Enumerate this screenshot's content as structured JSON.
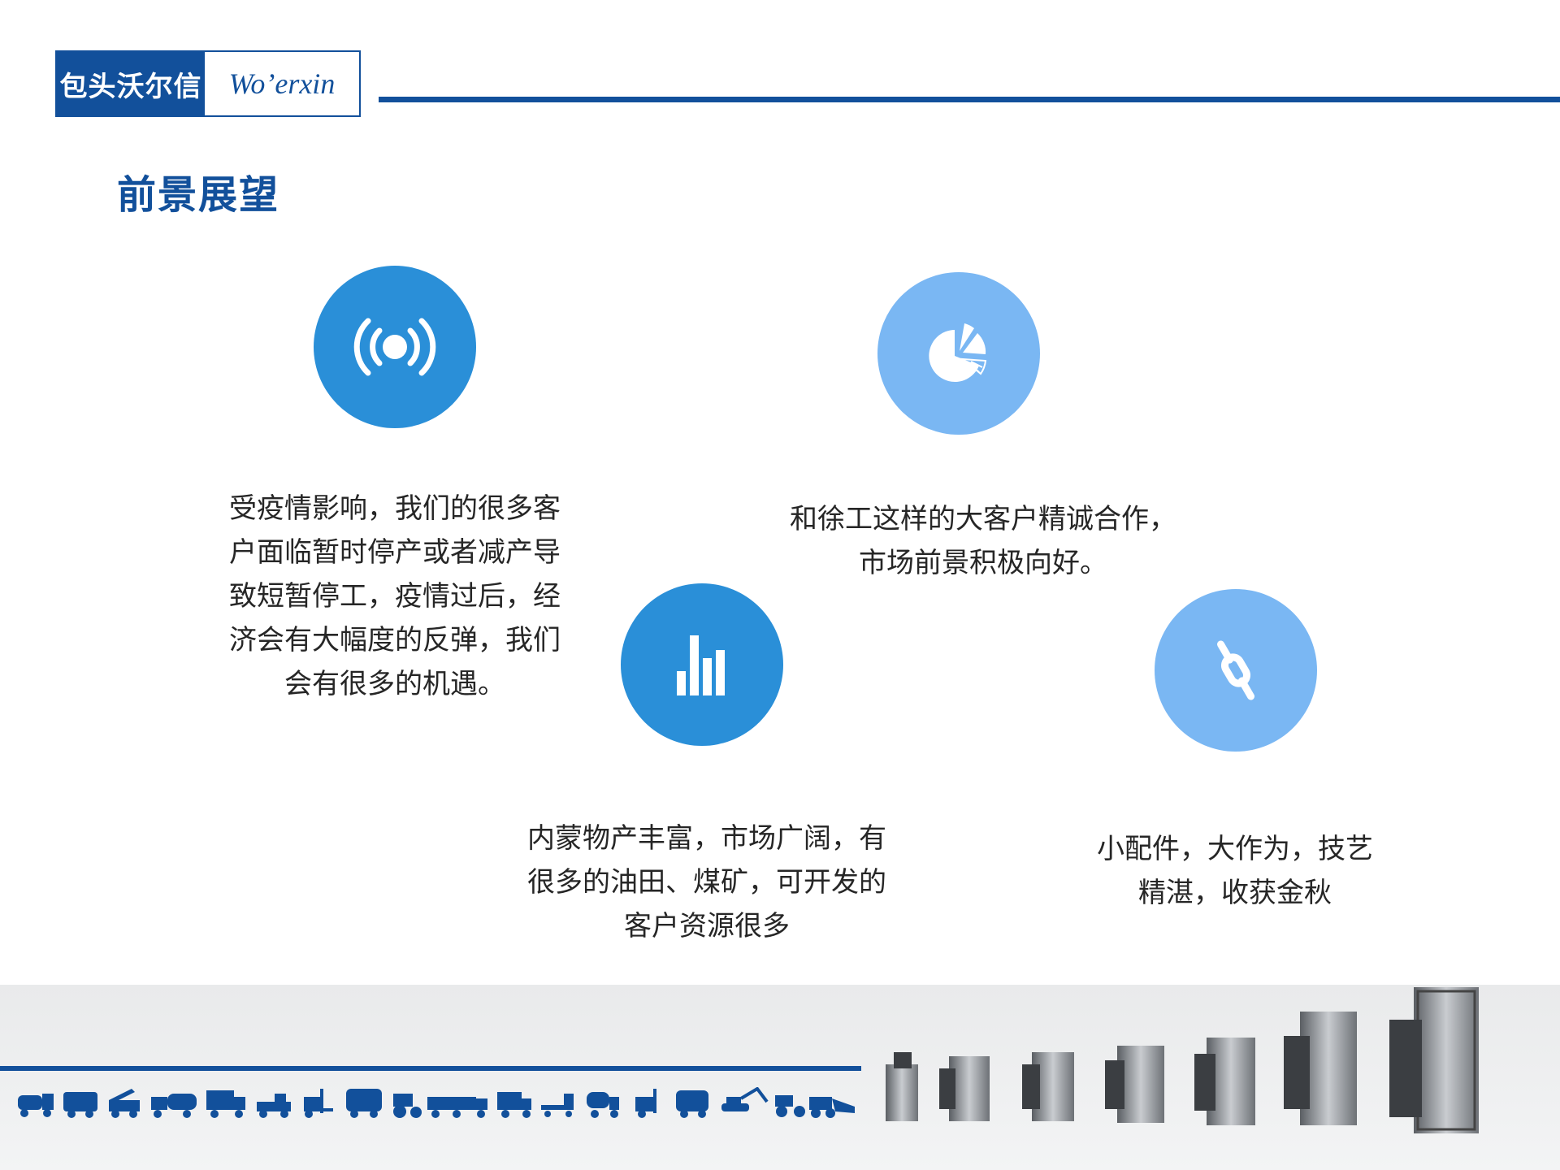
{
  "header": {
    "logo_cn": "包头沃尔信",
    "logo_en": "Wo’erxin"
  },
  "page_title": "前景展望",
  "colors": {
    "brand_blue": "#12509b",
    "circle_dark": "#2a8fd8",
    "circle_light": "#7ab7f3",
    "text": "#262626"
  },
  "items": [
    {
      "icon": "signal-broadcast-icon",
      "lines": [
        "受疫情影响，我们的很多客",
        "户面临暂时停产或者减产导",
        "致短暂停工，疫情过后，经",
        "济会有大幅度的反弹，我们",
        "会有很多的机遇。"
      ]
    },
    {
      "icon": "pie-chart-icon",
      "lines": [
        "和徐工这样的大客户精诚合作，",
        "市场前景积极向好。"
      ]
    },
    {
      "icon": "bar-chart-icon",
      "lines": [
        "内蒙物产丰富，市场广阔，有",
        "很多的油田、煤矿，可开发的",
        "客户资源很多"
      ]
    },
    {
      "icon": "chain-link-icon",
      "lines": [
        "小配件，大作为，技艺",
        "精湛，收获金秋"
      ]
    }
  ],
  "footer": {
    "vehicle_icons": "vehicle-icons-strip",
    "product_images": "diesel-generator-images"
  }
}
